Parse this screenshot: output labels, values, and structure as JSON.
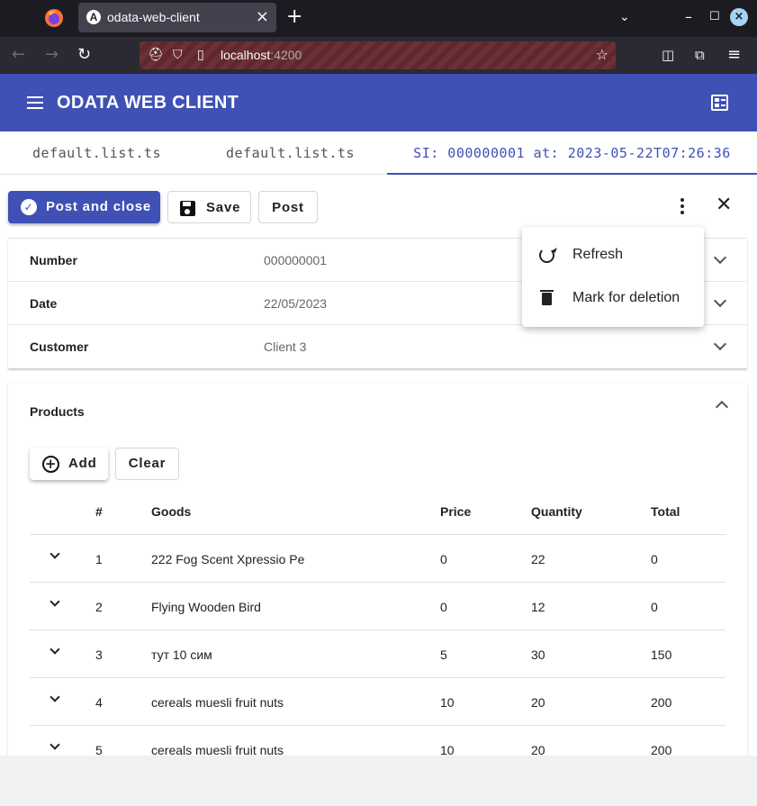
{
  "browser": {
    "tab_title": "odata-web-client",
    "url_host": "localhost",
    "url_port": ":4200"
  },
  "app": {
    "title": "ODATA WEB CLIENT"
  },
  "tabs": [
    {
      "label": "default.list.ts"
    },
    {
      "label": "default.list.ts"
    },
    {
      "label": "SI: 000000001 at: 2023-05-22T07:26:36"
    }
  ],
  "actions": {
    "post_and_close": "Post and close",
    "save": "Save",
    "post": "Post"
  },
  "menu": {
    "refresh": "Refresh",
    "mark_for_deletion": "Mark for deletion"
  },
  "fields": [
    {
      "label": "Number",
      "value": "000000001"
    },
    {
      "label": "Date",
      "value": "22/05/2023"
    },
    {
      "label": "Customer",
      "value": "Client 3"
    }
  ],
  "products": {
    "title": "Products",
    "add_label": "Add",
    "clear_label": "Clear",
    "columns": [
      "#",
      "Goods",
      "Price",
      "Quantity",
      "Total"
    ],
    "rows": [
      {
        "num": "1",
        "goods": "222 Fog Scent Xpressio Pe",
        "price": "0",
        "qty": "22",
        "total": "0"
      },
      {
        "num": "2",
        "goods": "Flying Wooden Bird",
        "price": "0",
        "qty": "12",
        "total": "0"
      },
      {
        "num": "3",
        "goods": "тут 10 сим",
        "price": "5",
        "qty": "30",
        "total": "150"
      },
      {
        "num": "4",
        "goods": "cereals muesli fruit nuts",
        "price": "10",
        "qty": "20",
        "total": "200"
      },
      {
        "num": "5",
        "goods": "cereals muesli fruit nuts",
        "price": "10",
        "qty": "20",
        "total": "200"
      }
    ]
  }
}
